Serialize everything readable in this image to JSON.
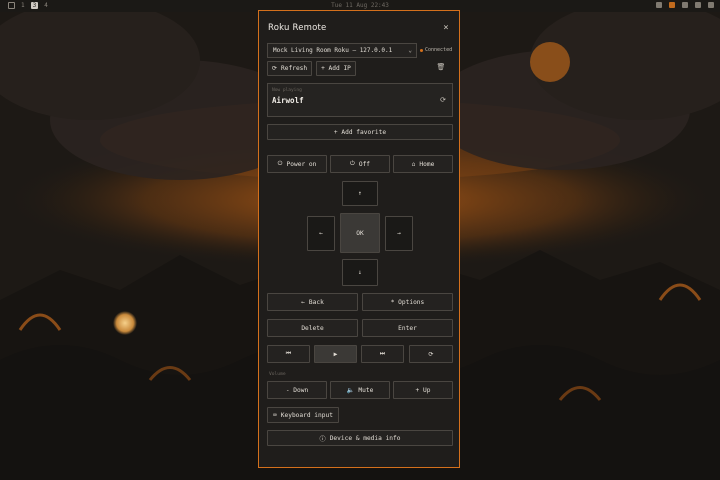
{
  "topbar": {
    "workspaces": [
      "1",
      "3",
      "4"
    ],
    "clock": "Tue 11 Aug 22:43"
  },
  "window": {
    "title": "Roku Remote",
    "close_label": "×",
    "device_select": "Mock Living Room Roku — 127.0.0.1",
    "status": "Connected",
    "refresh_label": "Refresh",
    "add_ip_label": "+ Add IP",
    "now_playing_label": "Now playing",
    "now_playing_title": "Airwolf",
    "add_favorite_label": "+ Add favorite",
    "power_on_label": "Power on",
    "off_label": "Off",
    "home_label": "Home",
    "ok_label": "OK",
    "back_label": "Back",
    "options_label": "* Options",
    "delete_label": "Delete",
    "enter_label": "Enter",
    "volume_label": "Volume",
    "vol_down_label": "- Down",
    "mute_label": "Mute",
    "vol_up_label": "+ Up",
    "keyboard_label": "Keyboard input",
    "device_info_label": "Device & media info"
  },
  "colors": {
    "accent": "#d4701c",
    "panel": "#1f1d1b"
  }
}
